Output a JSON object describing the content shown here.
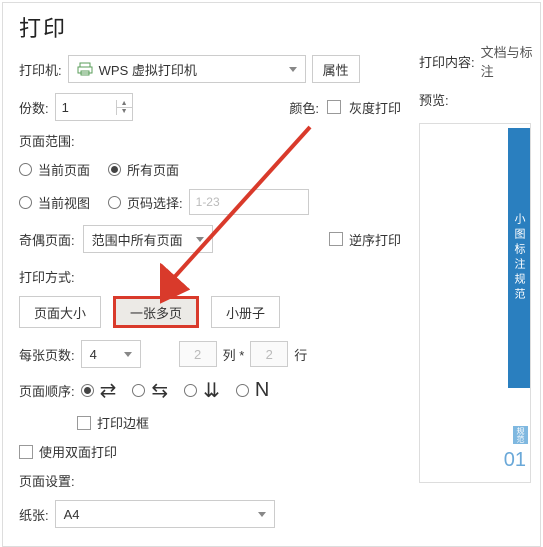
{
  "title": "打印",
  "printer": {
    "label": "打印机:",
    "value": "WPS 虚拟打印机",
    "properties_btn": "属性"
  },
  "copies": {
    "label": "份数:",
    "value": "1"
  },
  "color": {
    "label": "颜色:",
    "gray_label": "灰度打印"
  },
  "right": {
    "content_label": "打印内容:",
    "content_value": "文档与标注",
    "preview_label": "预览:",
    "preview_sidebar": "小图标注规范",
    "preview_page": "01",
    "preview_tag": "规范"
  },
  "range": {
    "section": "页面范围:",
    "current_page": "当前页面",
    "all_pages": "所有页面",
    "current_view": "当前视图",
    "page_select": "页码选择:",
    "page_placeholder": "1-23",
    "odd_even_label": "奇偶页面:",
    "odd_even_value": "范围中所有页面",
    "reverse": "逆序打印"
  },
  "mode": {
    "section": "打印方式:",
    "tab_size": "页面大小",
    "tab_multi": "一张多页",
    "tab_booklet": "小册子",
    "per_page_label": "每张页数:",
    "per_page_value": "4",
    "cols": "2",
    "rows": "2",
    "col_label": "列 *",
    "row_label": "行",
    "order_label": "页面顺序:",
    "border_label": "打印边框",
    "duplex_label": "使用双面打印"
  },
  "page_setup": {
    "section": "页面设置:",
    "paper_label": "纸张:",
    "paper_value": "A4"
  }
}
